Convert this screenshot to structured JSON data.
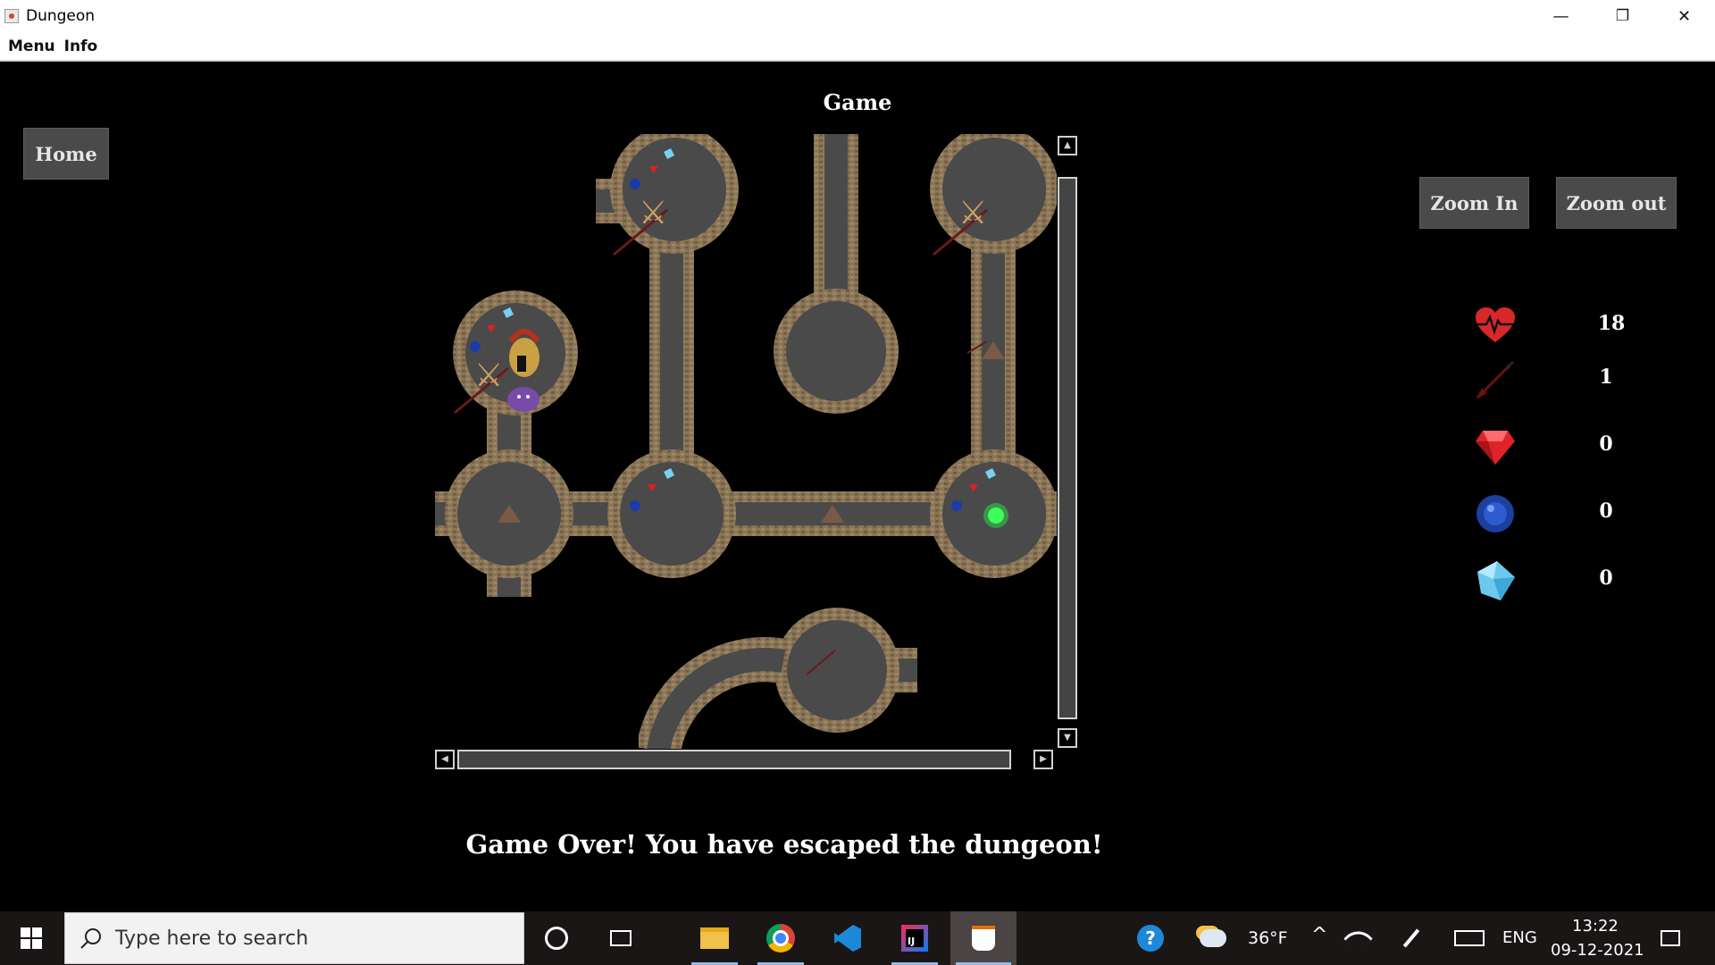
{
  "window": {
    "title": "Dungeon",
    "minimize": "—",
    "maximize": "❐",
    "close": "✕"
  },
  "menubar": {
    "items": [
      "Menu",
      "Info"
    ]
  },
  "game": {
    "title": "Game",
    "home_label": "Home",
    "zoom_in_label": "Zoom In",
    "zoom_out_label": "Zoom out",
    "status_message": "Game Over! You have escaped the dungeon!"
  },
  "stats": {
    "health": {
      "icon": "heart-icon",
      "value": "18"
    },
    "arrows": {
      "icon": "arrow-icon",
      "value": "1"
    },
    "rubies": {
      "icon": "ruby-icon",
      "value": "0"
    },
    "sapphires": {
      "icon": "sapphire-icon",
      "value": "0"
    },
    "diamonds": {
      "icon": "diamond-icon",
      "value": "0"
    }
  },
  "taskbar": {
    "search_placeholder": "Type here to search",
    "weather_temp": "36°F",
    "language": "ENG",
    "time": "13:22",
    "date": "09-12-2021"
  },
  "colors": {
    "stone": "#8a7556",
    "floor": "#4a4a4a",
    "button_bg": "#4a4a4a",
    "taskbar_bg": "#1a1616"
  }
}
